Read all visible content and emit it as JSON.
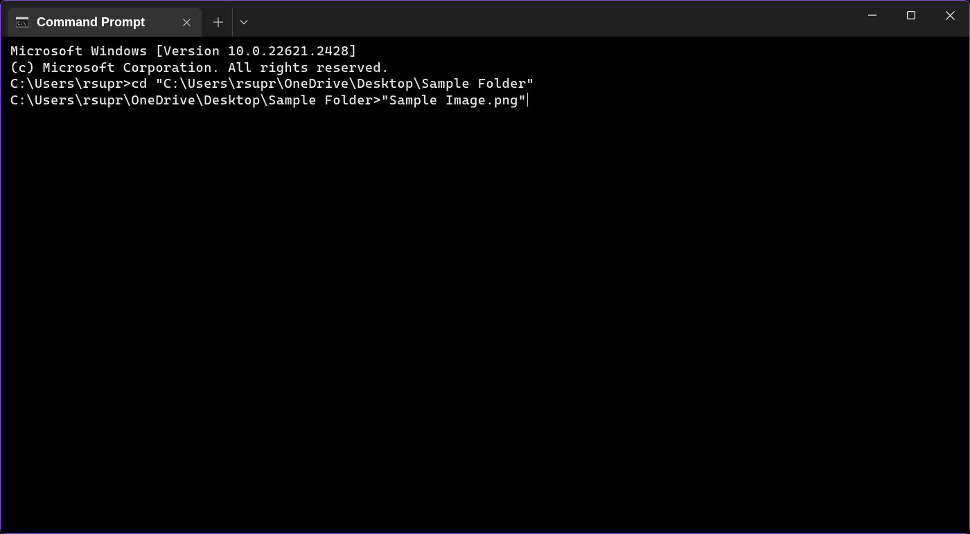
{
  "tab": {
    "title": "Command Prompt"
  },
  "terminal": {
    "lines": [
      "Microsoft Windows [Version 10.0.22621.2428]",
      "(c) Microsoft Corporation. All rights reserved.",
      "",
      "C:\\Users\\rsupr>cd \"C:\\Users\\rsupr\\OneDrive\\Desktop\\Sample Folder\"",
      "",
      "C:\\Users\\rsupr\\OneDrive\\Desktop\\Sample Folder>\"Sample Image.png\""
    ]
  }
}
